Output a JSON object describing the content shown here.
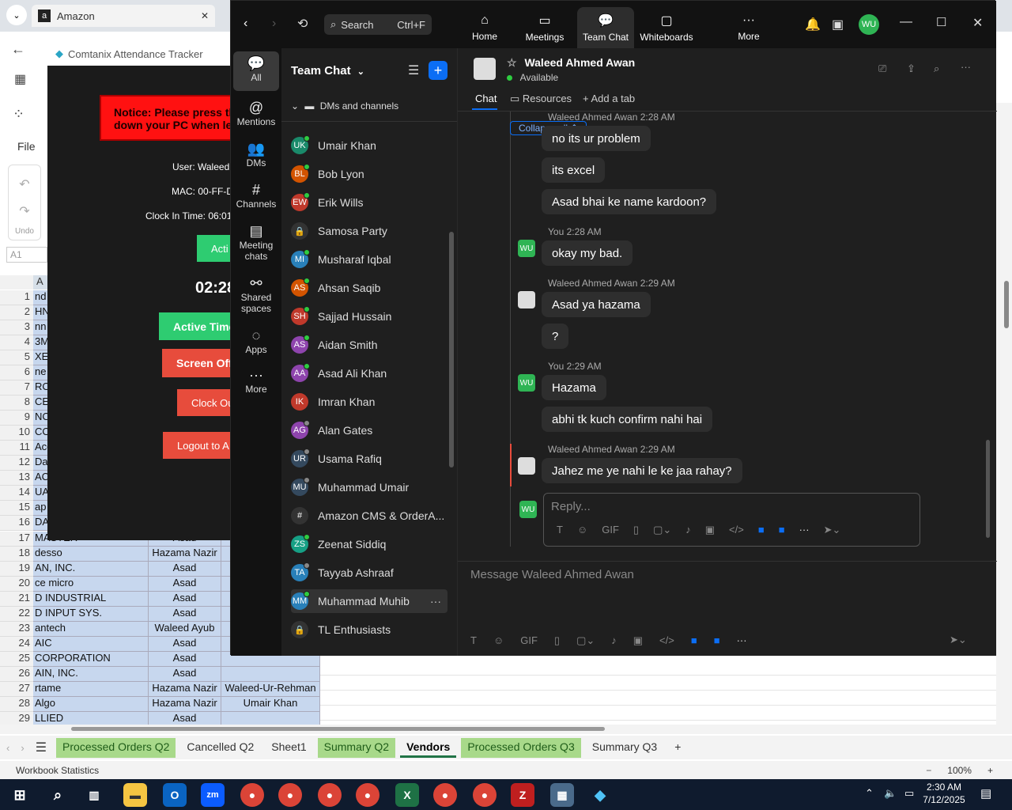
{
  "browser": {
    "tab_title": "Amazon",
    "close": "✕"
  },
  "excel": {
    "file_label": "File",
    "undo_label": "Undo",
    "name_box": "A1",
    "col_a_header": "A",
    "rows": [
      {
        "n": "17",
        "a": "MASTER",
        "b": "Asad",
        "c": ""
      },
      {
        "n": "18",
        "a": "desso",
        "b": "Hazama Nazir",
        "c": ""
      },
      {
        "n": "19",
        "a": "AN, INC.",
        "b": "Asad",
        "c": ""
      },
      {
        "n": "20",
        "a": "ce micro",
        "b": "Asad",
        "c": ""
      },
      {
        "n": "21",
        "a": "D INDUSTRIAL",
        "b": "Asad",
        "c": ""
      },
      {
        "n": "22",
        "a": "D INPUT SYS.",
        "b": "Asad",
        "c": ""
      },
      {
        "n": "23",
        "a": "antech",
        "b": "Waleed Ayub",
        "c": ""
      },
      {
        "n": "24",
        "a": "AIC",
        "b": "Asad",
        "c": ""
      },
      {
        "n": "25",
        "a": "CORPORATION",
        "b": "Asad",
        "c": ""
      },
      {
        "n": "26",
        "a": "AIN, INC.",
        "b": "Asad",
        "c": ""
      },
      {
        "n": "27",
        "a": "rtame",
        "b": "Hazama Nazir",
        "c": "Waleed-Ur-Rehman"
      },
      {
        "n": "28",
        "a": "Algo",
        "b": "Hazama Nazir",
        "c": "Umair Khan"
      },
      {
        "n": "29",
        "a": "LLIED",
        "b": "Asad",
        "c": ""
      }
    ],
    "hidden_rows_left": [
      {
        "n": "1",
        "a": "nd"
      },
      {
        "n": "2",
        "a": "HN"
      },
      {
        "n": "3",
        "a": "nn"
      },
      {
        "n": "4",
        "a": "3M"
      },
      {
        "n": "5",
        "a": "XE"
      },
      {
        "n": "6",
        "a": "ne"
      },
      {
        "n": "7",
        "a": "RO"
      },
      {
        "n": "8",
        "a": "CE"
      },
      {
        "n": "9",
        "a": "NC"
      },
      {
        "n": "10",
        "a": "CO"
      },
      {
        "n": "11",
        "a": "Ace"
      },
      {
        "n": "12",
        "a": "Da"
      },
      {
        "n": "13",
        "a": "ACT"
      },
      {
        "n": "14",
        "a": "UA"
      },
      {
        "n": "15",
        "a": "ap"
      },
      {
        "n": "16",
        "a": "DA"
      }
    ],
    "sheet_tabs": [
      {
        "label": "Processed Orders Q2",
        "style": "green"
      },
      {
        "label": "Cancelled Q2",
        "style": "plain"
      },
      {
        "label": "Sheet1",
        "style": "plain"
      },
      {
        "label": "Summary Q2",
        "style": "green"
      },
      {
        "label": "Vendors",
        "style": "active"
      },
      {
        "label": "Processed Orders Q3",
        "style": "green"
      },
      {
        "label": "Summary Q3",
        "style": "plain"
      },
      {
        "label": "+",
        "style": "plain"
      }
    ],
    "status_left": "Workbook Statistics",
    "zoom_level": "100%"
  },
  "tracker": {
    "title": "Comtanix Attendance Tracker",
    "notice": "Notice: Please press th",
    "notice2": "down your PC when le",
    "user": "User: Waleed",
    "mac": "MAC: 00-FF-D",
    "clock_in": "Clock In Time: 06:01",
    "active_small": "Acti",
    "timer": "02:28",
    "active_time": "Active Time",
    "screen_off": "Screen Off",
    "clock_out": "Clock Ou",
    "logout": "Logout to A"
  },
  "zoom": {
    "search_label": "Search",
    "search_shortcut": "Ctrl+F",
    "top_nav": [
      {
        "label": "Home",
        "icon": "⌂"
      },
      {
        "label": "Meetings",
        "icon": "▭"
      },
      {
        "label": "Team Chat",
        "icon": "💬"
      },
      {
        "label": "Whiteboards",
        "icon": "▢"
      },
      {
        "label": "More",
        "icon": "···"
      }
    ],
    "user_initials": "WU",
    "left_nav": [
      {
        "label": "All",
        "icon": "💬"
      },
      {
        "label": "Mentions",
        "icon": "@"
      },
      {
        "label": "DMs",
        "icon": "👥"
      },
      {
        "label": "Channels",
        "icon": "#"
      },
      {
        "label": "Meeting chats",
        "icon": "▤"
      },
      {
        "label": "Shared spaces",
        "icon": "⚯"
      },
      {
        "label": "Apps",
        "icon": "◌"
      },
      {
        "label": "More",
        "icon": "···"
      }
    ],
    "panel_title": "Team Chat",
    "section_label": "DMs and channels",
    "contacts": [
      {
        "initials": "UK",
        "name": "Umair Khan",
        "color": "#1a8a6a",
        "status": "#2ecc40"
      },
      {
        "initials": "BL",
        "name": "Bob Lyon",
        "color": "#d35400",
        "status": "#2ecc40"
      },
      {
        "initials": "EW",
        "name": "Erik Wills",
        "color": "#c0392b",
        "status": "#2ecc40"
      },
      {
        "initials": "🔒",
        "name": "Samosa Party",
        "color": "#333333",
        "status": ""
      },
      {
        "initials": "MI",
        "name": "Musharaf Iqbal",
        "color": "#2980b9",
        "status": "#2ecc40"
      },
      {
        "initials": "AS",
        "name": "Ahsan Saqib",
        "color": "#d35400",
        "status": "#2ecc40"
      },
      {
        "initials": "SH",
        "name": "Sajjad Hussain",
        "color": "#c0392b",
        "status": "#2ecc40"
      },
      {
        "initials": "AS",
        "name": "Aidan Smith",
        "color": "#8e44ad",
        "status": "#2ecc40"
      },
      {
        "initials": "AA",
        "name": "Asad Ali Khan",
        "color": "#8e44ad",
        "status": "#2ecc40"
      },
      {
        "initials": "IK",
        "name": "Imran Khan",
        "color": "#c0392b",
        "status": ""
      },
      {
        "initials": "AG",
        "name": "Alan Gates",
        "color": "#8e44ad",
        "status": "#888888"
      },
      {
        "initials": "UR",
        "name": "Usama Rafiq",
        "color": "#34495e",
        "status": "#888888"
      },
      {
        "initials": "MU",
        "name": "Muhammad Umair",
        "color": "#34495e",
        "status": "#888888"
      },
      {
        "initials": "#",
        "name": "Amazon CMS & OrderA...",
        "color": "#333333",
        "status": ""
      },
      {
        "initials": "ZS",
        "name": "Zeenat Siddiq",
        "color": "#16a085",
        "status": "#2ecc40"
      },
      {
        "initials": "TA",
        "name": "Tayyab Ashraaf",
        "color": "#2980b9",
        "status": "#888888"
      },
      {
        "initials": "MM",
        "name": "Muhammad Muhib",
        "color": "#2980b9",
        "status": "#2ecc40"
      },
      {
        "initials": "🔒",
        "name": "TL Enthusiasts",
        "color": "#333333",
        "status": ""
      }
    ],
    "chat_header": {
      "name": "Waleed Ahmed Awan",
      "status": "Available"
    },
    "tabs": [
      "Chat",
      "Resources",
      "Add a tab"
    ],
    "collapse_label": "Collapse all",
    "messages": [
      {
        "meta": "Waleed Ahmed Awan 2:28 AM",
        "lines": [
          "no its ur problem",
          "its excel",
          "Asad bhai ke name kardoon?"
        ]
      },
      {
        "meta": "You 2:28 AM",
        "lines": [
          "okay my bad."
        ]
      },
      {
        "meta": "Waleed Ahmed Awan 2:29 AM",
        "lines": [
          "Asad ya hazama",
          "?"
        ]
      },
      {
        "meta": "You 2:29 AM",
        "lines": [
          "Hazama",
          "abhi tk kuch confirm nahi hai"
        ]
      },
      {
        "meta": "Waleed Ahmed Awan 2:29 AM",
        "lines": [
          "Jahez me ye nahi le ke jaa rahay?"
        ]
      }
    ],
    "reply_placeholder": "Reply...",
    "message_placeholder": "Message Waleed Ahmed Awan",
    "gif_label": "GIF"
  },
  "taskbar": {
    "time": "2:30 AM",
    "date": "7/12/2025"
  }
}
